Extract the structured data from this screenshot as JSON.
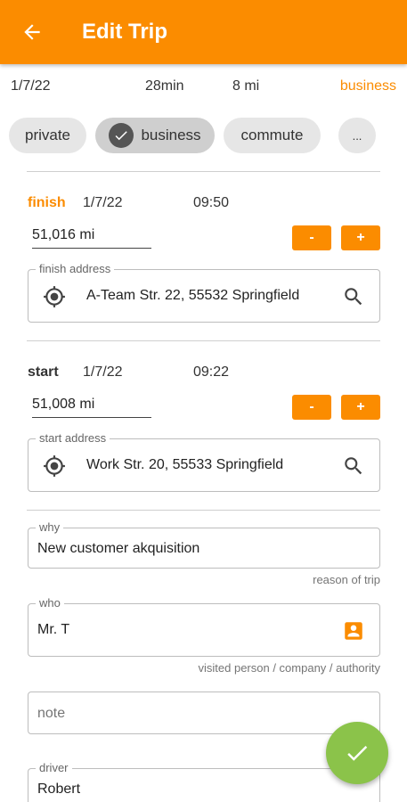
{
  "appbar": {
    "title": "Edit Trip",
    "back_icon": "arrow-left-icon",
    "color": "#fb8c00"
  },
  "summary": {
    "date": "1/7/22",
    "duration": "28min",
    "distance": "8 mi",
    "category": "business"
  },
  "chips": [
    {
      "label": "private",
      "selected": false
    },
    {
      "label": "business",
      "selected": true
    },
    {
      "label": "commute",
      "selected": false
    },
    {
      "label": "...",
      "selected": false
    }
  ],
  "finish": {
    "label": "finish",
    "date": "1/7/22",
    "time": "09:50",
    "odometer": "51,016 mi",
    "minus_label": "-",
    "plus_label": "+",
    "address_label": "finish address",
    "address": "A-Team Str. 22, 55532 Springfield"
  },
  "start": {
    "label": "start",
    "date": "1/7/22",
    "time": "09:22",
    "odometer": "51,008 mi",
    "minus_label": "-",
    "plus_label": "+",
    "address_label": "start address",
    "address": "Work Str. 20, 55533 Springfield"
  },
  "why": {
    "label": "why",
    "value": "New customer akquisition",
    "helper": "reason of trip"
  },
  "who": {
    "label": "who",
    "value": "Mr. T",
    "helper": "visited person / company / authority",
    "icon": "contact-card-icon"
  },
  "note": {
    "placeholder": "note"
  },
  "driver": {
    "label": "driver",
    "value": "Robert"
  },
  "fab": {
    "icon": "check-icon",
    "color": "#8bc34a"
  }
}
